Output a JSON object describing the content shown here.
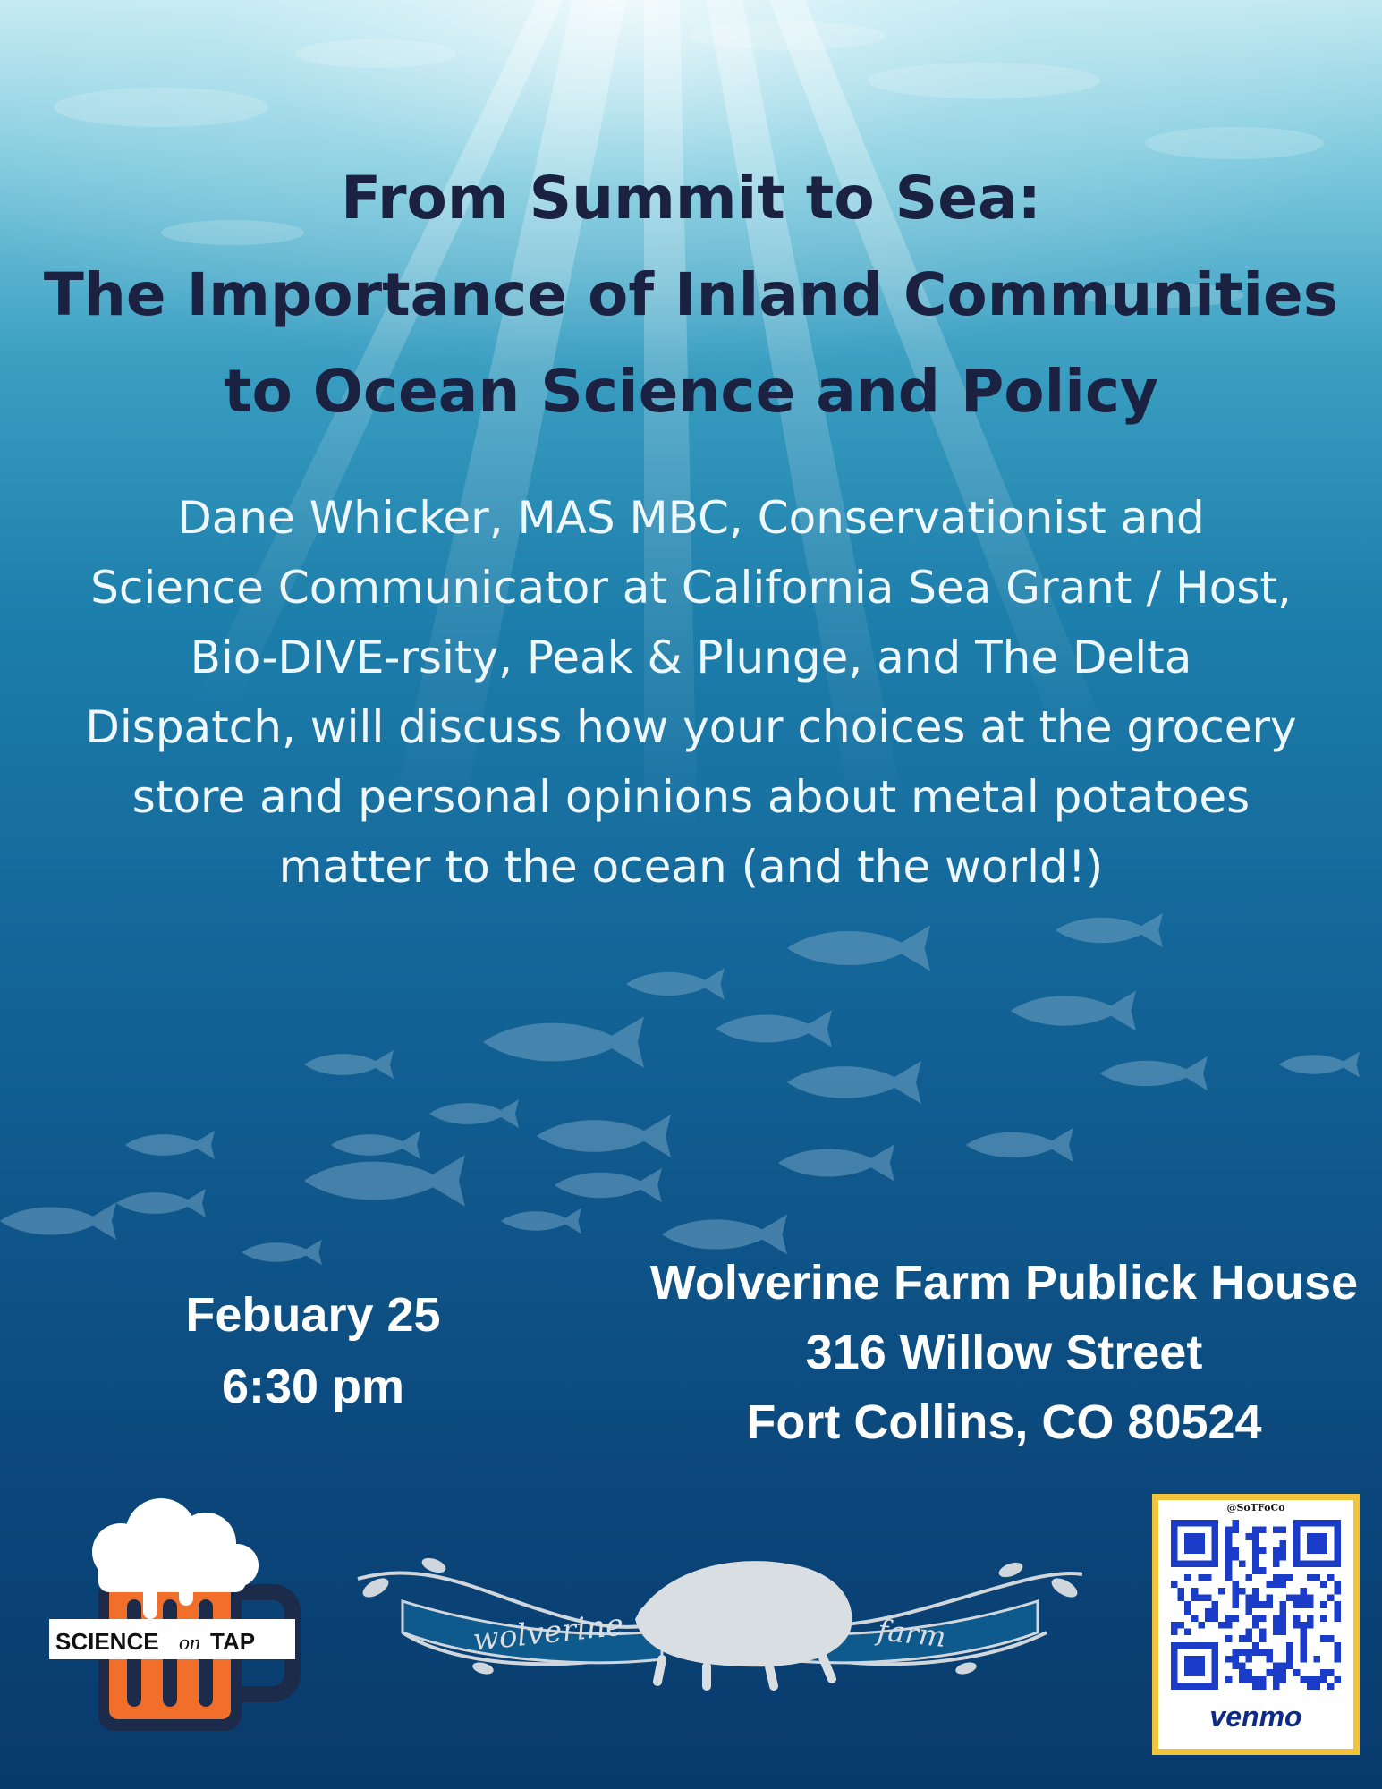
{
  "title": {
    "line1": "From Summit to Sea:",
    "line2": "The Importance of Inland Communities",
    "line3": "to Ocean Science and Policy"
  },
  "description": {
    "lines": [
      "Dane Whicker, MAS MBC, Conservationist and",
      "Science Communicator at California Sea Grant / Host,",
      "Bio-DIVE-rsity, Peak & Plunge, and The Delta",
      "Dispatch, will discuss how your choices at the grocery",
      "store and personal opinions about metal potatoes",
      "matter to the ocean (and the world!)"
    ]
  },
  "event": {
    "date": "Febuary 25",
    "time": "6:30 pm"
  },
  "venue": {
    "name": "Wolverine Farm Publick House",
    "street": "316 Willow Street",
    "city": "Fort Collins, CO 80524"
  },
  "logos": {
    "science_on_tap": {
      "word1": "SCIENCE",
      "word2": "on",
      "word3": "TAP"
    },
    "wolverine_farm": {
      "left_text": "wolverine",
      "right_text": "farm"
    }
  },
  "venmo": {
    "handle": "@SoTFoCo",
    "brand": "venmo"
  },
  "colors": {
    "title": "#1b2140",
    "body_text": "#eef7fb",
    "mug_orange": "#f26f2b",
    "venmo_blue": "#0c2a8a",
    "venmo_border": "#f2c23a"
  }
}
